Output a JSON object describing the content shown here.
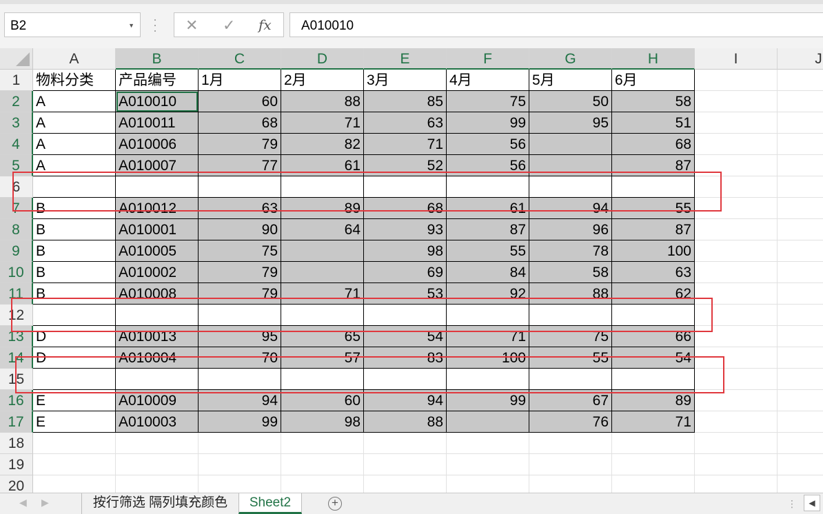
{
  "name_box": {
    "value": "B2"
  },
  "formula_bar": {
    "value": "A010010",
    "cancel_icon": "✕",
    "enter_icon": "✓",
    "fx_label": "fx"
  },
  "columns": [
    "A",
    "B",
    "C",
    "D",
    "E",
    "F",
    "G",
    "H",
    "I",
    "J"
  ],
  "rows": [
    "1",
    "2",
    "3",
    "4",
    "5",
    "6",
    "7",
    "8",
    "9",
    "10",
    "11",
    "12",
    "13",
    "14",
    "15",
    "16",
    "17",
    "18",
    "19",
    "20"
  ],
  "selection": {
    "active_cell": "B2",
    "selected_columns": [
      "B",
      "C",
      "D",
      "E",
      "F",
      "G",
      "H"
    ],
    "selected_rows": [
      "2",
      "3",
      "4",
      "5",
      "7",
      "8",
      "9",
      "10",
      "11",
      "13",
      "14",
      "16",
      "17"
    ]
  },
  "table": {
    "headers": [
      "物料分类",
      "产品编号",
      "1月",
      "2月",
      "3月",
      "4月",
      "5月",
      "6月"
    ],
    "rows": [
      [
        "A",
        "A010010",
        "60",
        "88",
        "85",
        "75",
        "50",
        "58"
      ],
      [
        "A",
        "A010011",
        "68",
        "71",
        "63",
        "99",
        "95",
        "51"
      ],
      [
        "A",
        "A010006",
        "79",
        "82",
        "71",
        "56",
        "",
        "68"
      ],
      [
        "A",
        "A010007",
        "77",
        "61",
        "52",
        "56",
        "",
        "87"
      ],
      [
        "",
        "",
        "",
        "",
        "",
        "",
        "",
        ""
      ],
      [
        "B",
        "A010012",
        "63",
        "89",
        "68",
        "61",
        "94",
        "55"
      ],
      [
        "B",
        "A010001",
        "90",
        "64",
        "93",
        "87",
        "96",
        "87"
      ],
      [
        "B",
        "A010005",
        "75",
        "",
        "98",
        "55",
        "78",
        "100"
      ],
      [
        "B",
        "A010002",
        "79",
        "",
        "69",
        "84",
        "58",
        "63"
      ],
      [
        "B",
        "A010008",
        "79",
        "71",
        "53",
        "92",
        "88",
        "62"
      ],
      [
        "",
        "",
        "",
        "",
        "",
        "",
        "",
        ""
      ],
      [
        "D",
        "A010013",
        "95",
        "65",
        "54",
        "71",
        "75",
        "66"
      ],
      [
        "D",
        "A010004",
        "70",
        "57",
        "83",
        "100",
        "55",
        "54"
      ],
      [
        "",
        "",
        "",
        "",
        "",
        "",
        "",
        ""
      ],
      [
        "E",
        "A010009",
        "94",
        "60",
        "94",
        "99",
        "67",
        "89"
      ],
      [
        "E",
        "A010003",
        "99",
        "98",
        "88",
        "",
        "76",
        "71"
      ]
    ]
  },
  "sheet_tabs": [
    {
      "label": "按行筛选 隔列填充颜色",
      "active": false
    },
    {
      "label": "Sheet2",
      "active": true
    }
  ],
  "colors": {
    "accent": "#217346",
    "highlight_box": "#e0383e",
    "fill_gray": "#c8c8c8"
  }
}
